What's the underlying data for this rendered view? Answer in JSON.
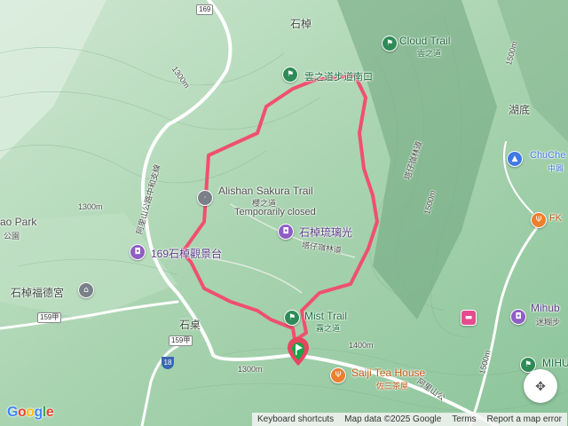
{
  "labels": {
    "shizhuo_top": "石棹",
    "cloud_trail": "Cloud Trail",
    "cloud_trail_zh": "雲之道",
    "cloud_trail_entrance": "雲之道步道南口",
    "hudi": "湖底",
    "chuche": "ChuChe",
    "chuche_zh": "中興",
    "fk": "FK",
    "sakura_trail": "Alishan Sakura Trail",
    "sakura_trail_zh": "櫻之道",
    "temporarily_closed": "Temporarily closed",
    "glass_house": "石棹琉璃光",
    "platform": "169石棹觀景台",
    "tree_trail": "塔仔嶺林道",
    "tree_trail_2": "塔仔嶺林道",
    "ao_park": "ao Park",
    "park_zh": "公園",
    "temple": "石棹福德宮",
    "mist_trail": "Mist Trail",
    "mist_trail_zh": "霧之道",
    "shizhuo": "石桌",
    "saiji": "Saiji Tea House",
    "saiji_zh": "佐三茶屋",
    "mihub": "Mihub",
    "mihub_zh": "迷糊步",
    "mihu": "MIHU",
    "road_vertical": "阿里山公路中和支線",
    "road_bottom": "阿里山公",
    "e1300a": "1300m",
    "e1300b": "1300m",
    "e1300c": "1300m",
    "e1400": "1400m",
    "e1500": "1500m",
    "e1500b": "1500m",
    "e1500c": "1500m"
  },
  "shields": {
    "r169": "169",
    "r159a": "159甲",
    "r159b": "159甲",
    "r18": "18"
  },
  "attribution": {
    "shortcuts": "Keyboard shortcuts",
    "mapdata": "Map data ©2025 Google",
    "terms": "Terms",
    "report": "Report a map error"
  },
  "logo": "Google",
  "colors": {
    "route": "#f0506e",
    "terrain": "#a9d4b0",
    "road": "#ffffff"
  }
}
